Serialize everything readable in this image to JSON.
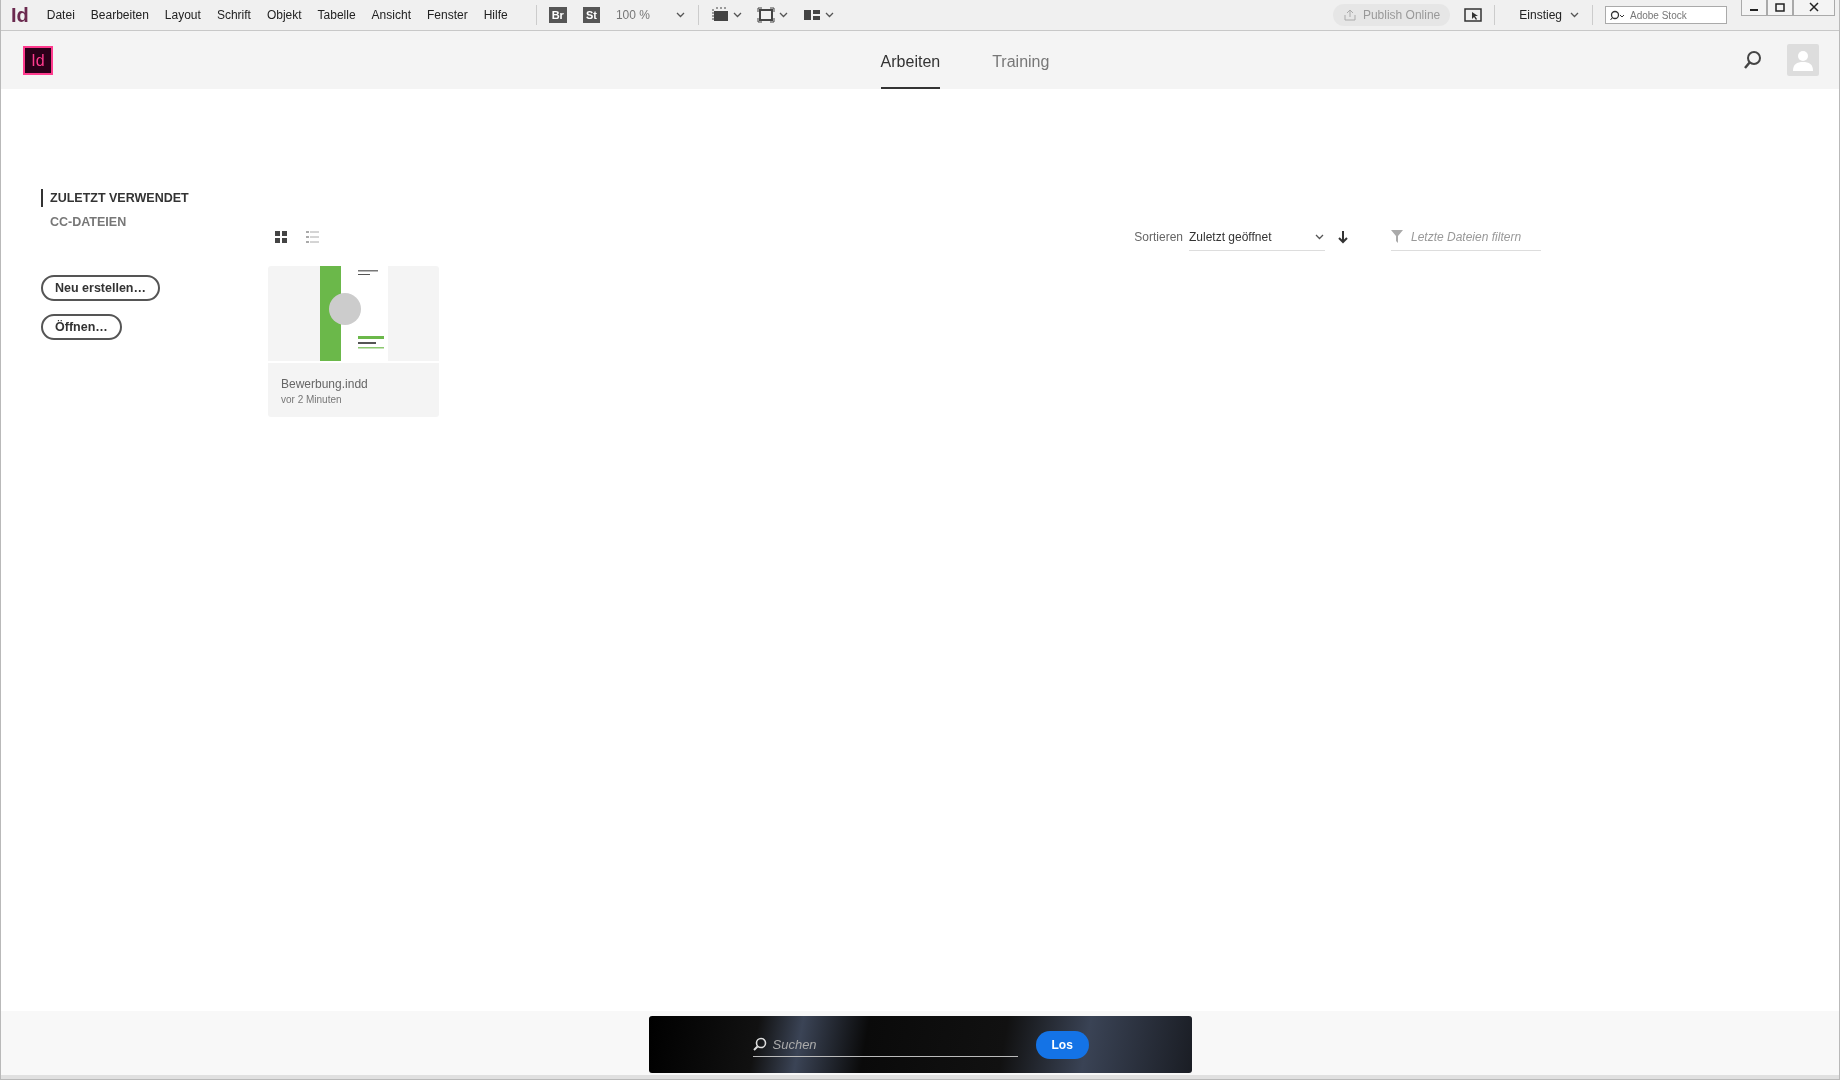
{
  "app_icon": "Id",
  "menu": [
    "Datei",
    "Bearbeiten",
    "Layout",
    "Schrift",
    "Objekt",
    "Tabelle",
    "Ansicht",
    "Fenster",
    "Hilfe"
  ],
  "toolbar": {
    "bridge": "Br",
    "stock": "St",
    "zoom": "100 %",
    "publish": "Publish Online",
    "workspace": "Einstieg",
    "stock_search_placeholder": "Adobe Stock"
  },
  "logo": "Id",
  "tabs": [
    {
      "label": "Arbeiten",
      "selected": true
    },
    {
      "label": "Training",
      "selected": false
    }
  ],
  "view_modes": [
    {
      "kind": "grid",
      "selected": true
    },
    {
      "kind": "list",
      "selected": false
    }
  ],
  "sort": {
    "label": "Sortieren",
    "value": "Zuletzt geöffnet"
  },
  "filter": {
    "placeholder": "Letzte Dateien filtern"
  },
  "nav": [
    {
      "label": "ZULETZT VERWENDET",
      "selected": true
    },
    {
      "label": "CC-DATEIEN",
      "selected": false
    }
  ],
  "actions": [
    "Neu erstellen…",
    "Öffnen…"
  ],
  "files": [
    {
      "name": "Bewerbung.indd",
      "time": "vor 2 Minuten"
    }
  ],
  "search": {
    "placeholder": "Suchen",
    "button": "Los"
  }
}
